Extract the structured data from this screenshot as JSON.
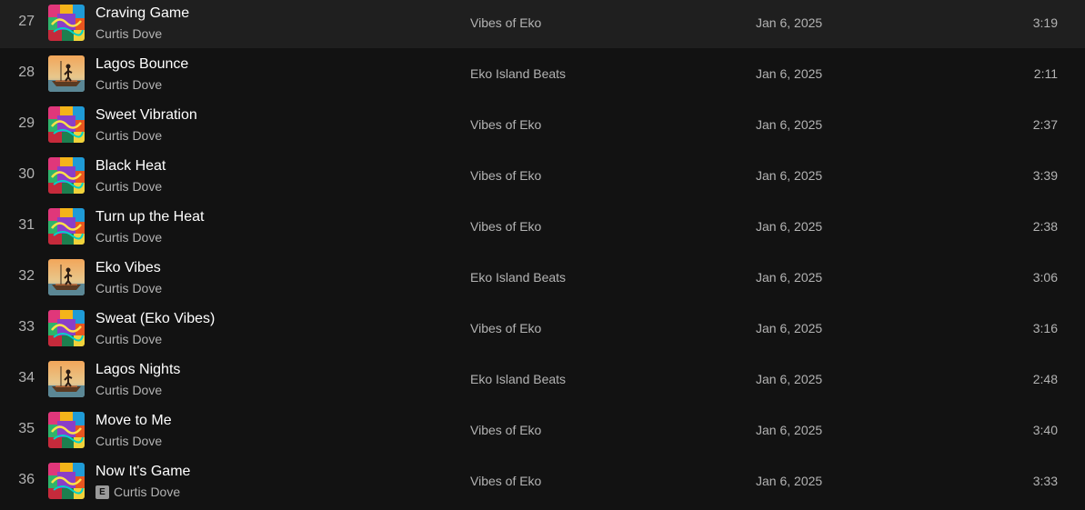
{
  "tracks": [
    {
      "num": "27",
      "title": "Craving Game",
      "artist": "Curtis Dove",
      "album": "Vibes of Eko",
      "date": "Jan 6, 2025",
      "duration": "3:19",
      "cover": "vibes",
      "explicit": false
    },
    {
      "num": "28",
      "title": "Lagos Bounce",
      "artist": "Curtis Dove",
      "album": "Eko Island Beats",
      "date": "Jan 6, 2025",
      "duration": "2:11",
      "cover": "island",
      "explicit": false
    },
    {
      "num": "29",
      "title": "Sweet Vibration",
      "artist": "Curtis Dove",
      "album": "Vibes of Eko",
      "date": "Jan 6, 2025",
      "duration": "2:37",
      "cover": "vibes",
      "explicit": false
    },
    {
      "num": "30",
      "title": "Black Heat",
      "artist": "Curtis Dove",
      "album": "Vibes of Eko",
      "date": "Jan 6, 2025",
      "duration": "3:39",
      "cover": "vibes",
      "explicit": false
    },
    {
      "num": "31",
      "title": "Turn up the Heat",
      "artist": "Curtis Dove",
      "album": "Vibes of Eko",
      "date": "Jan 6, 2025",
      "duration": "2:38",
      "cover": "vibes",
      "explicit": false
    },
    {
      "num": "32",
      "title": "Eko Vibes",
      "artist": "Curtis Dove",
      "album": "Eko Island Beats",
      "date": "Jan 6, 2025",
      "duration": "3:06",
      "cover": "island",
      "explicit": false
    },
    {
      "num": "33",
      "title": "Sweat (Eko Vibes)",
      "artist": "Curtis Dove",
      "album": "Vibes of Eko",
      "date": "Jan 6, 2025",
      "duration": "3:16",
      "cover": "vibes",
      "explicit": false
    },
    {
      "num": "34",
      "title": "Lagos Nights",
      "artist": "Curtis Dove",
      "album": "Eko Island Beats",
      "date": "Jan 6, 2025",
      "duration": "2:48",
      "cover": "island",
      "explicit": false
    },
    {
      "num": "35",
      "title": "Move to Me",
      "artist": "Curtis Dove",
      "album": "Vibes of Eko",
      "date": "Jan 6, 2025",
      "duration": "3:40",
      "cover": "vibes",
      "explicit": false
    },
    {
      "num": "36",
      "title": "Now It's Game",
      "artist": "Curtis Dove",
      "album": "Vibes of Eko",
      "date": "Jan 6, 2025",
      "duration": "3:33",
      "cover": "vibes",
      "explicit": true
    }
  ],
  "explicit_label": "E",
  "colors": {
    "background": "#121212",
    "title": "#ffffff",
    "secondary": "#b3b3b3"
  }
}
